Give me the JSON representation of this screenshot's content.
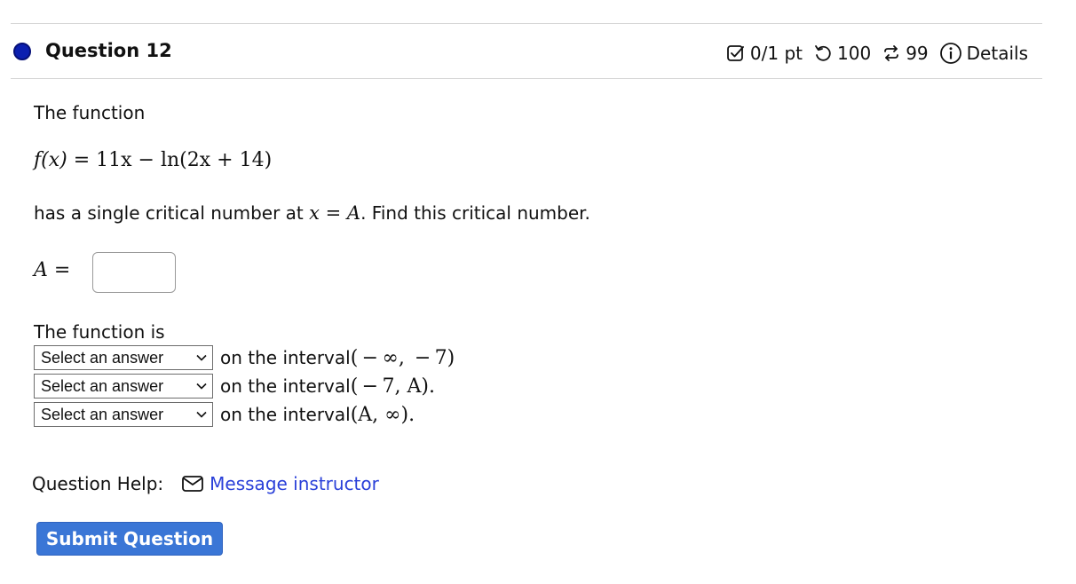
{
  "question": {
    "title": "Question 12",
    "score": "0/1 pt",
    "retries": "100",
    "attempts": "99",
    "details_label": "Details"
  },
  "prompt": {
    "intro": "The function",
    "function": "f(x) = 11x − ln(2x + 14)",
    "function_name": "f(x)",
    "function_rhs": "= 11x − ln(2x + 14)",
    "critical_prefix": "has a single critical number at ",
    "critical_math": "x = A",
    "critical_suffix": ". Find this critical number."
  },
  "answer": {
    "label": "A =",
    "value": ""
  },
  "intervals": {
    "intro": "The function is",
    "rows": [
      {
        "select": "Select an answer",
        "text": "on the interval ",
        "math": "( − ∞, − 7)"
      },
      {
        "select": "Select an answer",
        "text": "on the interval ",
        "math": "( − 7, A)."
      },
      {
        "select": "Select an answer",
        "text": "on the interval ",
        "math": "(A, ∞)."
      }
    ]
  },
  "help": {
    "label": "Question Help:",
    "message_link": "Message instructor"
  },
  "submit_label": "Submit Question",
  "colors": {
    "dot": "#0b1fb0",
    "link": "#2a40d9",
    "submit_bg": "#3a76d6"
  },
  "icons": [
    "check-square-icon",
    "retry-icon",
    "attempts-icon",
    "info-icon",
    "envelope-icon",
    "chevron-down-icon"
  ]
}
